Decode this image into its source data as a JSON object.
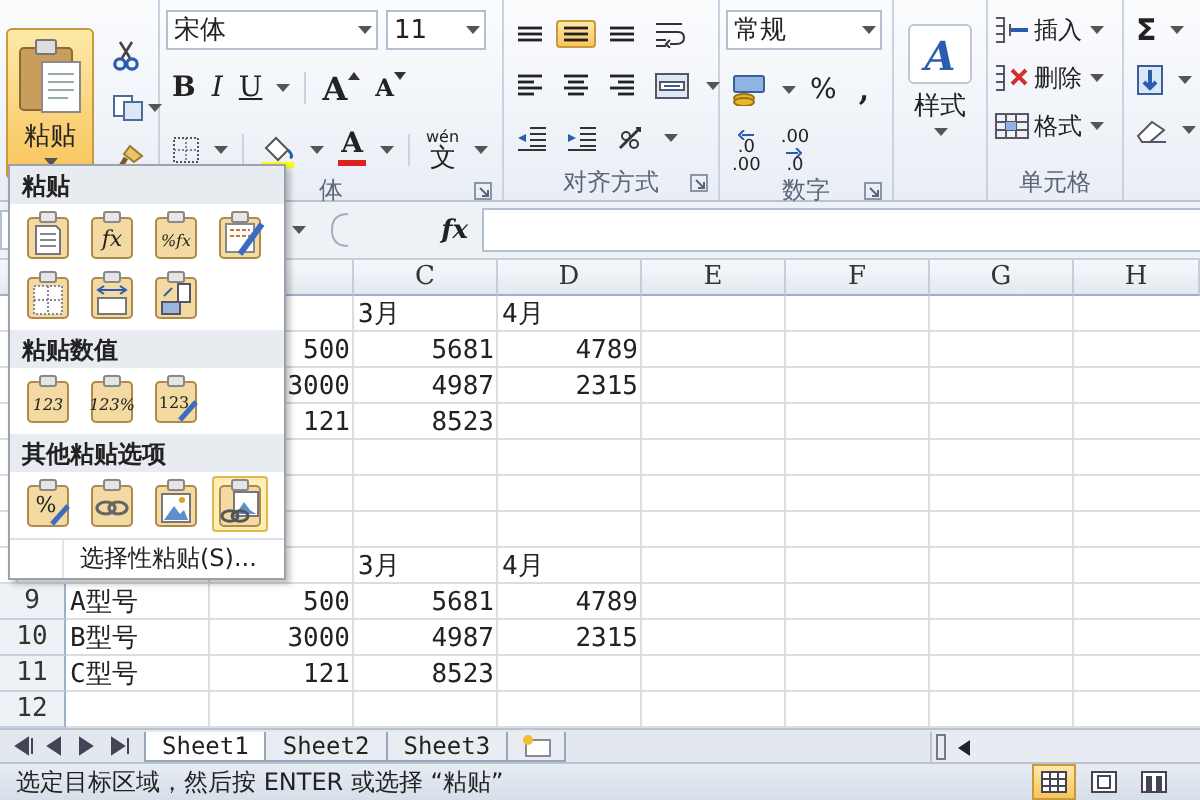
{
  "ribbon": {
    "paste": {
      "label": "粘贴",
      "open": true
    },
    "font": {
      "face": "宋体",
      "size": "11",
      "bold": "B",
      "italic": "I",
      "underline": "U",
      "grow": "A",
      "shrink": "A",
      "font_color": "A",
      "phonetic_ruby": "wén",
      "phonetic": "文",
      "label": "体"
    },
    "alignment": {
      "rows": [
        [
          {
            "kind": "top",
            "selected": false
          },
          {
            "kind": "middle",
            "selected": true
          },
          {
            "kind": "bottom",
            "selected": false
          },
          {
            "kind": "wrap",
            "selected": false
          }
        ],
        [
          {
            "kind": "left",
            "selected": false
          },
          {
            "kind": "center",
            "selected": false
          },
          {
            "kind": "right",
            "selected": false
          },
          {
            "kind": "merge",
            "selected": false
          }
        ],
        [
          {
            "kind": "outdent",
            "selected": false
          },
          {
            "kind": "indent",
            "selected": false
          },
          {
            "kind": "orientation",
            "selected": false
          }
        ]
      ],
      "label": "对齐方式"
    },
    "number": {
      "format": "常规",
      "percent": "%",
      "comma": ",",
      "increase_decimal": [
        ".0",
        ".00"
      ],
      "decrease_decimal": [
        ".00",
        ".0"
      ],
      "label": "数字"
    },
    "styles": {
      "glyph": "A",
      "label": "样式"
    },
    "cells": {
      "items": [
        {
          "kind": "insert",
          "label": "插入"
        },
        {
          "kind": "delete",
          "label": "删除"
        },
        {
          "kind": "format",
          "label": "格式"
        }
      ],
      "label": "单元格"
    },
    "editing": {
      "sum": "Σ"
    }
  },
  "formula_bar": {
    "fx": "fx"
  },
  "paste_menu": {
    "sections": [
      {
        "title": "粘贴",
        "options": [
          {
            "kind": "all",
            "selected": false
          },
          {
            "kind": "glyph",
            "glyph": "fx",
            "selected": false
          },
          {
            "kind": "glyph",
            "glyph": "%fx",
            "selected": false
          },
          {
            "kind": "brush",
            "selected": false
          },
          {
            "kind": "no-borders",
            "selected": false
          },
          {
            "kind": "column-width",
            "selected": false
          },
          {
            "kind": "transpose",
            "selected": false
          }
        ]
      },
      {
        "title": "粘贴数值",
        "options": [
          {
            "kind": "glyph",
            "glyph": "123",
            "selected": false
          },
          {
            "kind": "glyph",
            "glyph": "123%",
            "selected": false
          },
          {
            "kind": "glyph-brush",
            "glyph": "123",
            "selected": false
          }
        ]
      },
      {
        "title": "其他粘贴选项",
        "options": [
          {
            "kind": "glyph-brush",
            "glyph": "%",
            "selected": false
          },
          {
            "kind": "link",
            "selected": false
          },
          {
            "kind": "picture",
            "selected": false
          },
          {
            "kind": "linked-picture",
            "selected": true
          }
        ]
      }
    ],
    "special": "选择性粘贴(S)..."
  },
  "sheet": {
    "columns": [
      "C",
      "D",
      "E",
      "F",
      "G",
      "H"
    ],
    "rows": [
      {
        "cells": [
          null,
          null,
          {
            "text": "3月",
            "kind": "text"
          },
          {
            "text": "4月",
            "kind": "text"
          }
        ]
      },
      {
        "cells": [
          null,
          {
            "text": "500",
            "kind": "number"
          },
          {
            "text": "5681",
            "kind": "number"
          },
          {
            "text": "4789",
            "kind": "number"
          }
        ]
      },
      {
        "cells": [
          null,
          {
            "text": "3000",
            "kind": "number"
          },
          {
            "text": "4987",
            "kind": "number"
          },
          {
            "text": "2315",
            "kind": "number"
          }
        ]
      },
      {
        "cells": [
          null,
          {
            "text": "121",
            "kind": "number"
          },
          {
            "text": "8523",
            "kind": "number"
          }
        ]
      },
      {},
      {},
      {},
      {
        "cells": [
          null,
          null,
          {
            "text": "3月",
            "kind": "text"
          },
          {
            "text": "4月",
            "kind": "text"
          }
        ]
      },
      {
        "number": "9",
        "cells": [
          {
            "text": "A型号",
            "kind": "text"
          },
          {
            "text": "500",
            "kind": "number"
          },
          {
            "text": "5681",
            "kind": "number"
          },
          {
            "text": "4789",
            "kind": "number"
          }
        ]
      },
      {
        "number": "10",
        "cells": [
          {
            "text": "B型号",
            "kind": "text"
          },
          {
            "text": "3000",
            "kind": "number"
          },
          {
            "text": "4987",
            "kind": "number"
          },
          {
            "text": "2315",
            "kind": "number"
          }
        ]
      },
      {
        "number": "11",
        "cells": [
          {
            "text": "C型号",
            "kind": "text"
          },
          {
            "text": "121",
            "kind": "number"
          },
          {
            "text": "8523",
            "kind": "number"
          }
        ]
      },
      {
        "number": "12"
      }
    ]
  },
  "sheet_tabs": [
    {
      "label": "Sheet1",
      "selected": true
    },
    {
      "label": "Sheet2",
      "selected": false
    },
    {
      "label": "Sheet3",
      "selected": false
    }
  ],
  "status_bar": {
    "text": "选定目标区域，然后按 ENTER 或选择 “粘贴”",
    "views": [
      {
        "kind": "normal",
        "selected": true
      },
      {
        "kind": "page-layout",
        "selected": false
      },
      {
        "kind": "page-break",
        "selected": false
      }
    ]
  }
}
